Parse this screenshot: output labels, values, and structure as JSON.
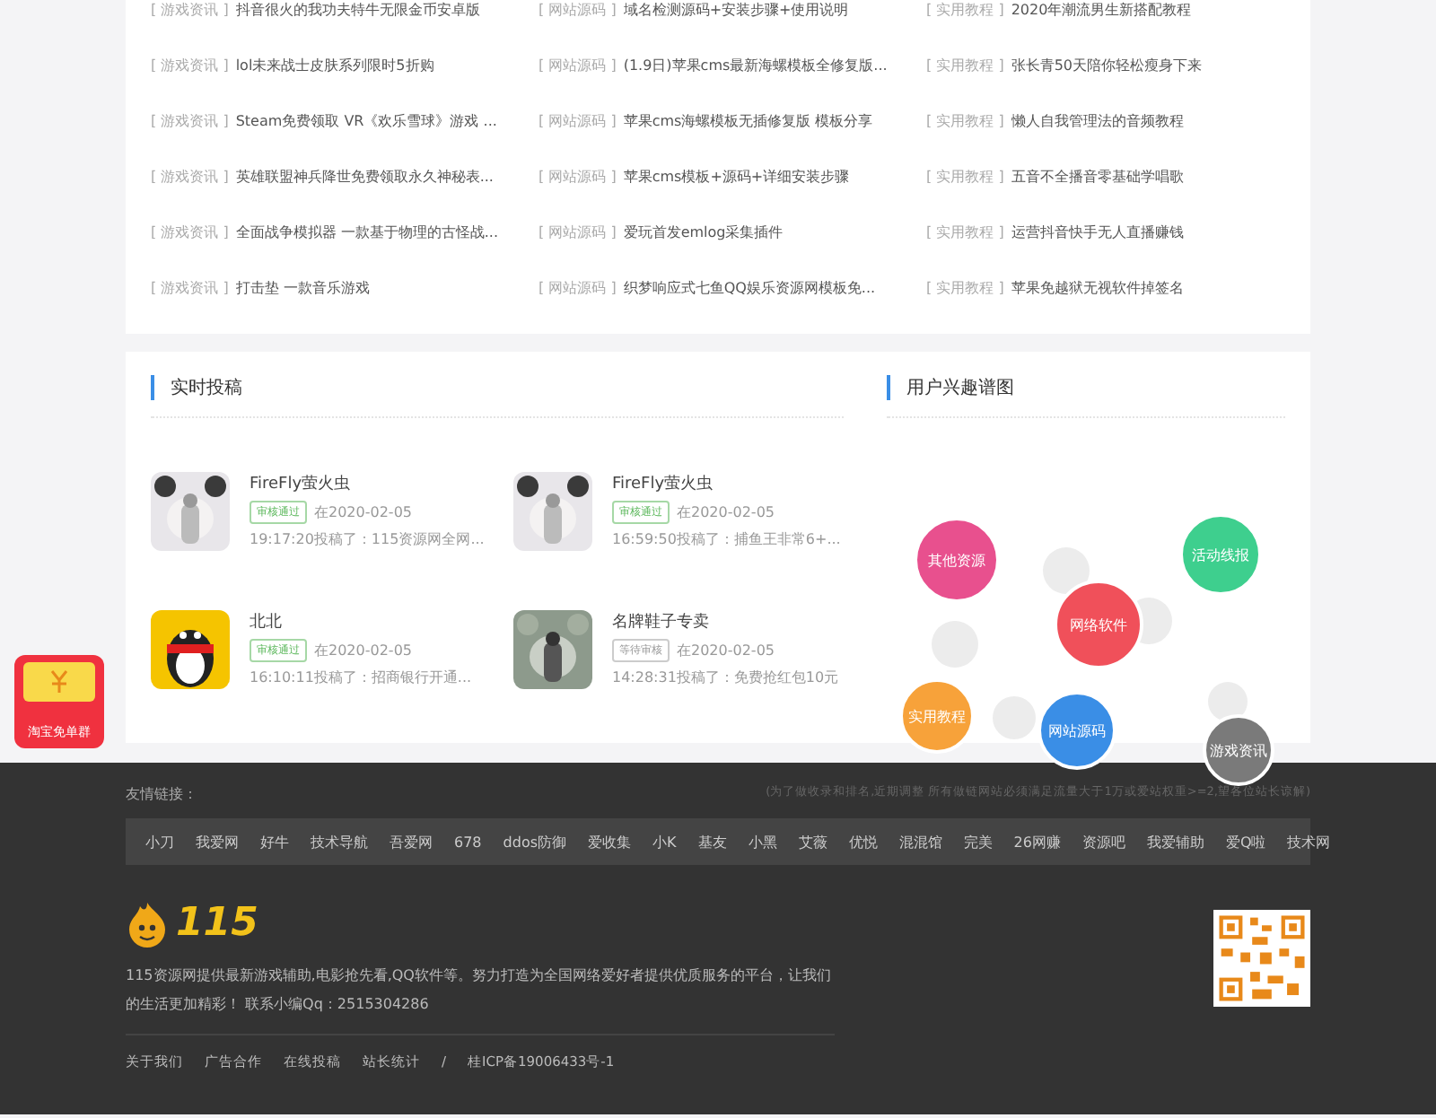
{
  "article_list": [
    {
      "tag": "[ 游戏资讯 ]",
      "title": "抖音很火的我功夫特牛无限金币安卓版"
    },
    {
      "tag": "[ 网站源码 ]",
      "title": "域名检测源码+安装步骤+使用说明"
    },
    {
      "tag": "[ 实用教程 ]",
      "title": "2020年潮流男生新搭配教程"
    },
    {
      "tag": "[ 游戏资讯 ]",
      "title": "lol未来战士皮肤系列限时5折购"
    },
    {
      "tag": "[ 网站源码 ]",
      "title": "(1.9日)苹果cms最新海螺模板全修复版..."
    },
    {
      "tag": "[ 实用教程 ]",
      "title": "张长青50天陪你轻松瘦身下来"
    },
    {
      "tag": "[ 游戏资讯 ]",
      "title": "Steam免费领取 VR《欢乐雪球》游戏 ..."
    },
    {
      "tag": "[ 网站源码 ]",
      "title": "苹果cms海螺模板无插修复版 模板分享"
    },
    {
      "tag": "[ 实用教程 ]",
      "title": "懒人自我管理法的音频教程"
    },
    {
      "tag": "[ 游戏资讯 ]",
      "title": "英雄联盟神兵降世免费领取永久神秘表..."
    },
    {
      "tag": "[ 网站源码 ]",
      "title": "苹果cms模板+源码+详细安装步骤"
    },
    {
      "tag": "[ 实用教程 ]",
      "title": "五音不全播音零基础学唱歌"
    },
    {
      "tag": "[ 游戏资讯 ]",
      "title": "全面战争模拟器 一款基于物理的古怪战..."
    },
    {
      "tag": "[ 网站源码 ]",
      "title": "爱玩首发emlog采集插件"
    },
    {
      "tag": "[ 实用教程 ]",
      "title": "运营抖音快手无人直播赚钱"
    },
    {
      "tag": "[ 游戏资讯 ]",
      "title": "打击垫 一款音乐游戏"
    },
    {
      "tag": "[ 网站源码 ]",
      "title": "织梦响应式七鱼QQ娱乐资源网模板免..."
    },
    {
      "tag": "[ 实用教程 ]",
      "title": "苹果免越狱无视软件掉签名"
    }
  ],
  "submissions": {
    "title": "实时投稿",
    "items": [
      {
        "kind": "picture",
        "name": "FireFly萤火虫",
        "status": "审核通过",
        "approved": true,
        "date": "在2020-02-05",
        "detail": "19:17:20投稿了：115资源网全网..."
      },
      {
        "kind": "picture",
        "name": "FireFly萤火虫",
        "status": "审核通过",
        "approved": true,
        "date": "在2020-02-05",
        "detail": "16:59:50投稿了：捕鱼王非常6+..."
      },
      {
        "kind": "penguin",
        "name": "北北",
        "status": "审核通过",
        "approved": true,
        "date": "在2020-02-05",
        "detail": "16:10:11投稿了：招商银行开通..."
      },
      {
        "kind": "picture",
        "name": "名牌鞋子专卖",
        "status": "等待审核",
        "approved": false,
        "date": "在2020-02-05",
        "detail": "14:28:31投稿了：免费抢红包10元"
      }
    ]
  },
  "interest_map": {
    "title": "用户兴趣谱图",
    "bubbles": [
      {
        "label": "其他资源",
        "color": "#e8508e"
      },
      {
        "label": "活动线报",
        "color": "#3ecf8e"
      },
      {
        "label": "网络软件",
        "color": "#f0505a"
      },
      {
        "label": "实用教程",
        "color": "#f7a23a"
      },
      {
        "label": "网站源码",
        "color": "#3a8ee6"
      },
      {
        "label": "游戏资讯",
        "color": "#7a7a7a"
      }
    ]
  },
  "floating_badge": {
    "label": "淘宝免单群"
  },
  "footer": {
    "links_label": "友情链接：",
    "links_note": "(为了做收录和排名,近期调整 所有做链网站必须满足流量大于1万或爱站权重>=2,望各位站长谅解)",
    "links": [
      "小刀",
      "我爱网",
      "好牛",
      "技术导航",
      "吾爱网",
      "678",
      "ddos防御",
      "爱收集",
      "小K",
      "基友",
      "小黑",
      "艾薇",
      "优悦",
      "混混馆",
      "完美",
      "26网赚",
      "资源吧",
      "我爱辅助",
      "爱Q啦",
      "技术网"
    ],
    "logo_text": "115",
    "description": "115资源网提供最新游戏辅助,电影抢先看,QQ软件等。努力打造为全国网络爱好者提供优质服务的平台，让我们的生活更加精彩！ 联系小编Qq：2515304286",
    "bottom_links": [
      "关于我们",
      "广告合作",
      "在线投稿",
      "站长统计"
    ],
    "separator": "/",
    "icp": "桂ICP备19006433号-1"
  }
}
